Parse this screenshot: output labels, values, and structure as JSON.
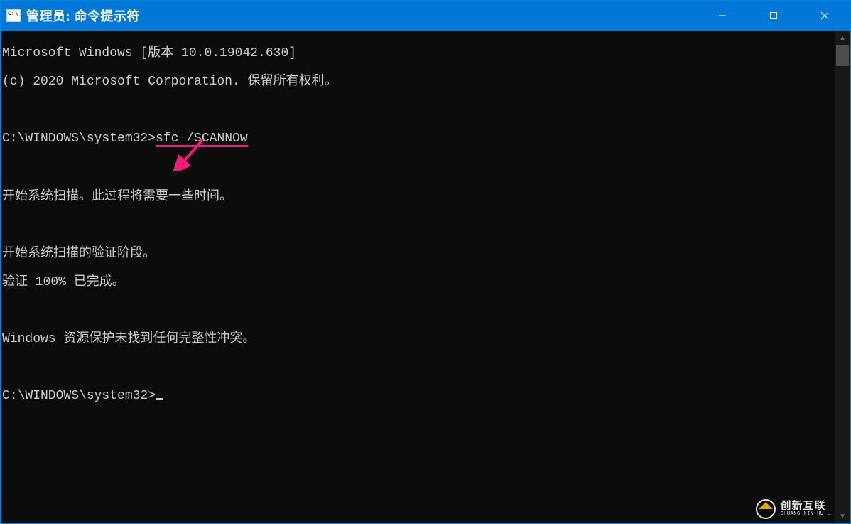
{
  "titlebar": {
    "title": "管理员: 命令提示符"
  },
  "terminal": {
    "line_version": "Microsoft Windows [版本 10.0.19042.630]",
    "line_copyright": "(c) 2020 Microsoft Corporation. 保留所有权利。",
    "prompt1_path": "C:\\WINDOWS\\system32>",
    "prompt1_cmd": "sfc /SCANNOw",
    "line_scan_start": "开始系统扫描。此过程将需要一些时间。",
    "line_verify_phase": "开始系统扫描的验证阶段。",
    "line_verify_done": "验证 100% 已完成。",
    "line_result": "Windows 资源保护未找到任何完整性冲突。",
    "prompt2_path": "C:\\WINDOWS\\system32>"
  },
  "annotation": {
    "arrow_color": "#ED1E79"
  },
  "watermark": {
    "cn": "创新互联",
    "en": "CHUANG XIN HU L"
  }
}
